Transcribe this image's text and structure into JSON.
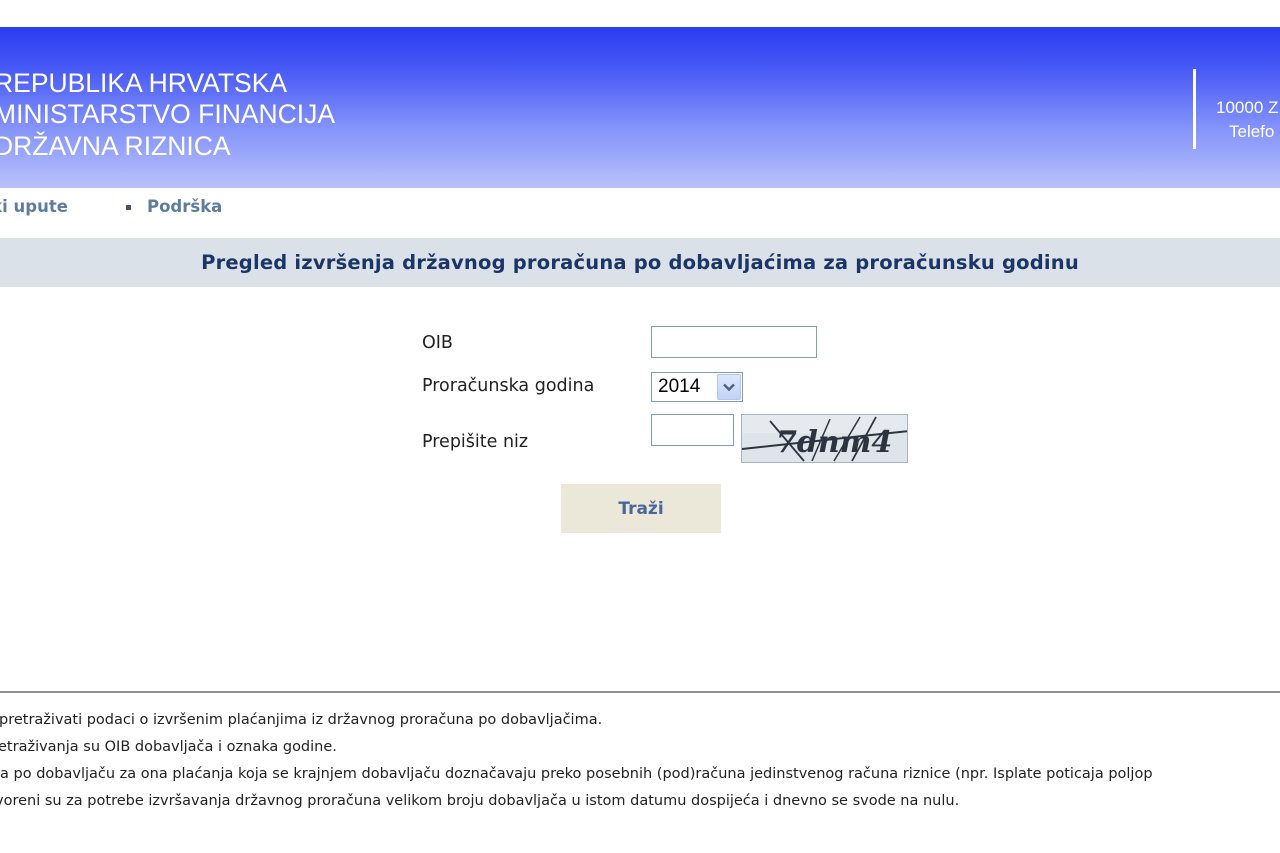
{
  "header": {
    "title_lines": [
      "REPUBLIKA HRVATSKA",
      "MINISTARSTVO FINANCIJA",
      "DRŽAVNA RIZNICA"
    ],
    "contact_lines": [
      "10000 Z",
      "Telefo"
    ],
    "colors": {
      "banner_top": "#2a3bf2",
      "banner_bottom": "#b9c1fc"
    }
  },
  "nav": {
    "items": [
      {
        "label": "nički upute"
      },
      {
        "label": "Podrška"
      }
    ]
  },
  "page_title": "Pregled izvršenja državnog proračuna po dobavljaćima za proračunsku godinu",
  "form": {
    "oib_label": "OIB",
    "oib_value": "",
    "year_label": "Proračunska godina",
    "year_selected": "2014",
    "captcha_label": "Prepišite niz",
    "captcha_value": "",
    "captcha_text": "7dnm4",
    "submit_label": "Traži"
  },
  "footer": {
    "lines": [
      "pretraživati podaci o izvršenim plaćanjima iz državnog proračuna po dobavljačima.",
      "etraživanja su OIB dobavljača i oznaka godine.",
      "ja po dobavljaču za ona plaćanja koja se krajnjem dobavljaču doznačavaju preko posebnih (pod)računa jedinstvenog računa riznice (npr. Isplate poticaja poljop",
      "voreni su za potrebe izvršavanja državnog proračuna velikom broju dobavljača u istom datumu dospijeća i dnevno se svode na nulu."
    ]
  }
}
